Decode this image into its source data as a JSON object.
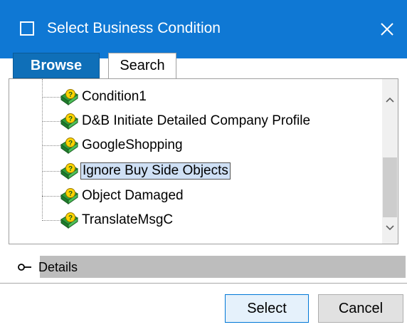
{
  "window": {
    "title": "Select Business Condition",
    "close_icon": "close-icon",
    "accent_color": "#0f78d4"
  },
  "tabs": [
    {
      "label": "Browse",
      "active": true
    },
    {
      "label": "Search",
      "active": false
    }
  ],
  "tree": {
    "items": [
      {
        "label": "Condition1",
        "icon": "business-condition-icon",
        "selected": false
      },
      {
        "label": "D&B Initiate Detailed Company Profile",
        "icon": "business-condition-icon",
        "selected": false
      },
      {
        "label": "GoogleShopping",
        "icon": "business-condition-icon",
        "selected": false
      },
      {
        "label": "Ignore Buy Side Objects",
        "icon": "business-condition-icon",
        "selected": true
      },
      {
        "label": "Object Damaged",
        "icon": "business-condition-icon",
        "selected": false
      },
      {
        "label": "TranslateMsgC",
        "icon": "business-condition-icon",
        "selected": false
      }
    ]
  },
  "details": {
    "label": "Details",
    "icon": "expand-toggle-icon"
  },
  "buttons": {
    "select_label": "Select",
    "cancel_label": "Cancel"
  }
}
